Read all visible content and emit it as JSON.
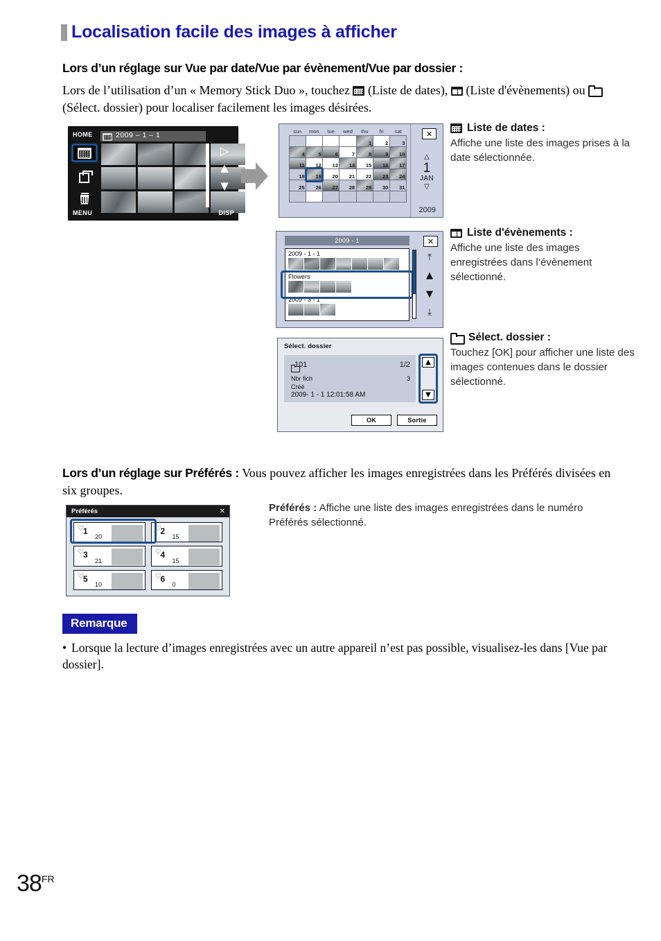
{
  "page": {
    "title": "Localisation facile des images à afficher",
    "number": "38",
    "number_suffix": "FR"
  },
  "section1": {
    "heading": "Lors d’un réglage sur Vue par date/Vue par évènement/Vue par dossier :",
    "intro_part1": "Lors de l’utilisation d’un « Memory Stick Duo », touchez",
    "intro_part2": "(Liste de dates),",
    "intro_part3": "(Liste d'évènements) ou",
    "intro_part4": "(Sélect. dossier) pour localiser facilement les images désirées."
  },
  "camera_screen": {
    "home_label": "HOME",
    "menu_label": "MENU",
    "disp_label": "DISP",
    "date_label": "2009 – 1 – 1",
    "date_icon": "date-list-icon",
    "left_icons": [
      "date-list-icon",
      "multi-burst-icon",
      "trash-icon"
    ],
    "right_icons": [
      "rotate-playback-icon",
      "page-up-icon",
      "page-down-icon"
    ]
  },
  "arrow": {
    "name": "flow-arrow-right"
  },
  "calendar_panel": {
    "close_label": "✕",
    "dow": [
      "sun",
      "mon",
      "tue",
      "wed",
      "thu",
      "fri",
      "sat"
    ],
    "year": "2009",
    "month_number": "1",
    "month_abbr": "JAN",
    "up_arrow": "△",
    "down_arrow": "▽",
    "selected_day": 19,
    "cells": [
      {
        "day": "",
        "type": "blank"
      },
      {
        "day": "",
        "type": "empty"
      },
      {
        "day": "",
        "type": "empty"
      },
      {
        "day": "",
        "type": "empty"
      },
      {
        "day": "1",
        "type": "photo"
      },
      {
        "day": "2",
        "type": "empty"
      },
      {
        "day": "3",
        "type": "blank"
      },
      {
        "day": "4",
        "type": "photo"
      },
      {
        "day": "5",
        "type": "photo"
      },
      {
        "day": "6",
        "type": "photo2"
      },
      {
        "day": "7",
        "type": "empty"
      },
      {
        "day": "8",
        "type": "photo"
      },
      {
        "day": "9",
        "type": "photo2"
      },
      {
        "day": "10",
        "type": "photo"
      },
      {
        "day": "11",
        "type": "photo2"
      },
      {
        "day": "12",
        "type": "empty"
      },
      {
        "day": "13",
        "type": "empty"
      },
      {
        "day": "14",
        "type": "photo"
      },
      {
        "day": "15",
        "type": "empty"
      },
      {
        "day": "16",
        "type": "photo2"
      },
      {
        "day": "17",
        "type": "photo"
      },
      {
        "day": "18",
        "type": "blank"
      },
      {
        "day": "19",
        "type": "photo"
      },
      {
        "day": "20",
        "type": "empty"
      },
      {
        "day": "21",
        "type": "empty"
      },
      {
        "day": "22",
        "type": "empty"
      },
      {
        "day": "23",
        "type": "photo2"
      },
      {
        "day": "24",
        "type": "photo"
      },
      {
        "day": "25",
        "type": "blank"
      },
      {
        "day": "26",
        "type": "blank"
      },
      {
        "day": "27",
        "type": "photo2"
      },
      {
        "day": "28",
        "type": "blank"
      },
      {
        "day": "29",
        "type": "photo"
      },
      {
        "day": "30",
        "type": "blank"
      },
      {
        "day": "31",
        "type": "blank"
      },
      {
        "day": "",
        "type": "blank"
      },
      {
        "day": "",
        "type": "empty"
      },
      {
        "day": "",
        "type": "blank"
      },
      {
        "day": "",
        "type": "blank"
      },
      {
        "day": "",
        "type": "blank"
      },
      {
        "day": "",
        "type": "blank"
      },
      {
        "day": "",
        "type": "blank"
      }
    ]
  },
  "event_panel": {
    "title": "2009 - 1",
    "close_label": "✕",
    "rows": [
      {
        "label": "2009 - 1 - 1",
        "thumbs": 7,
        "selected": false
      },
      {
        "label": "Flowers",
        "thumbs": 4,
        "selected": true
      },
      {
        "label": "2009 - 3 - 1",
        "thumbs": 3,
        "selected": false
      }
    ],
    "nav_icons": [
      "jump-top-icon",
      "scroll-up-icon",
      "scroll-down-icon",
      "jump-bottom-icon"
    ]
  },
  "folder_panel": {
    "title": "Sélect. dossier",
    "folder_name": "101",
    "page_indicator": "1/2",
    "file_count_label": "Nbr fich",
    "file_count_value": "3",
    "created_label": "Créé",
    "created_value": "2009- 1 - 1 12:01:58 AM",
    "up_label": "▲",
    "down_label": "▼",
    "ok_label": "OK",
    "exit_label": "Sortie"
  },
  "descriptions": [
    {
      "icon": "date-list-icon",
      "heading": "Liste de dates :",
      "body": "Affiche une liste des images prises à la date sélectionnée."
    },
    {
      "icon": "event-list-icon",
      "heading": "Liste d'évènements :",
      "body": "Affiche une liste des images enregistrées dans l’évènement sélectionné."
    },
    {
      "icon": "folder-icon",
      "heading": "Sélect. dossier :",
      "body": "Touchez [OK] pour afficher une liste des images contenues dans le dossier sélectionné."
    }
  ],
  "section2": {
    "heading": "Lors d’un réglage sur Préférés :",
    "body": "Vous pouvez afficher les images enregistrées dans les Préférés divisées en six groupes.",
    "desc_heading": "Préférés :",
    "desc_body": "Affiche une liste des images enregistrées dans le numéro Préférés sélectionné."
  },
  "favorites_panel": {
    "title": "Préférés",
    "close_label": "✕",
    "items": [
      {
        "number": "1",
        "count": "20",
        "selected": true,
        "has_image": true
      },
      {
        "number": "2",
        "count": "15",
        "selected": false,
        "has_image": true
      },
      {
        "number": "3",
        "count": "21",
        "selected": false,
        "has_image": true
      },
      {
        "number": "4",
        "count": "15",
        "selected": false,
        "has_image": true
      },
      {
        "number": "5",
        "count": "10",
        "selected": false,
        "has_image": true
      },
      {
        "number": "6",
        "count": "0",
        "selected": false,
        "has_image": false
      }
    ]
  },
  "remark": {
    "label": "Remarque",
    "bullet": "•",
    "text": "Lorsque la lecture d’images enregistrées avec un autre appareil n’est pas possible, visualisez-les dans [Vue par dossier]."
  },
  "colors": {
    "title_blue": "#1a1ab0",
    "selection_blue": "#1b4f8f",
    "remark_blue": "#1a1aa8",
    "panel_bg": "#ccd2e4"
  }
}
